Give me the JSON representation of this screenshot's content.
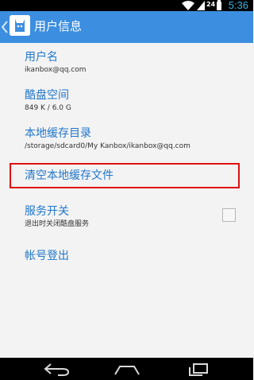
{
  "status_bar": {
    "network_type": "24",
    "time": "5:36",
    "wifi_icon": "wifi-icon",
    "signal_icon": "signal-icon",
    "battery_icon": "battery-icon"
  },
  "action_bar": {
    "title": "用户信息",
    "back_icon": "back-chevron-icon",
    "app_icon": "kanbox-app-icon",
    "color": "#3c8ee0"
  },
  "preferences": {
    "username": {
      "title": "用户名",
      "summary": "ikanbox@qq.com"
    },
    "storage": {
      "title": "酷盘空间",
      "summary": "849 K / 6.0 G"
    },
    "cache_dir": {
      "title": "本地缓存目录",
      "summary": "/storage/sdcard0/My Kanbox/ikanbox@qq.com"
    },
    "clear_cache": {
      "title": "清空本地缓存文件"
    },
    "service_toggle": {
      "title": "服务开关",
      "summary": "退出时关闭酷盘服务",
      "checked": false
    },
    "logout": {
      "title": "帐号登出"
    }
  },
  "nav_bar": {
    "back_icon": "nav-back-icon",
    "home_icon": "nav-home-icon",
    "recents_icon": "nav-recents-icon"
  },
  "colors": {
    "accent": "#2277cc",
    "highlight": "#e01010",
    "clock": "#33b5e5"
  }
}
